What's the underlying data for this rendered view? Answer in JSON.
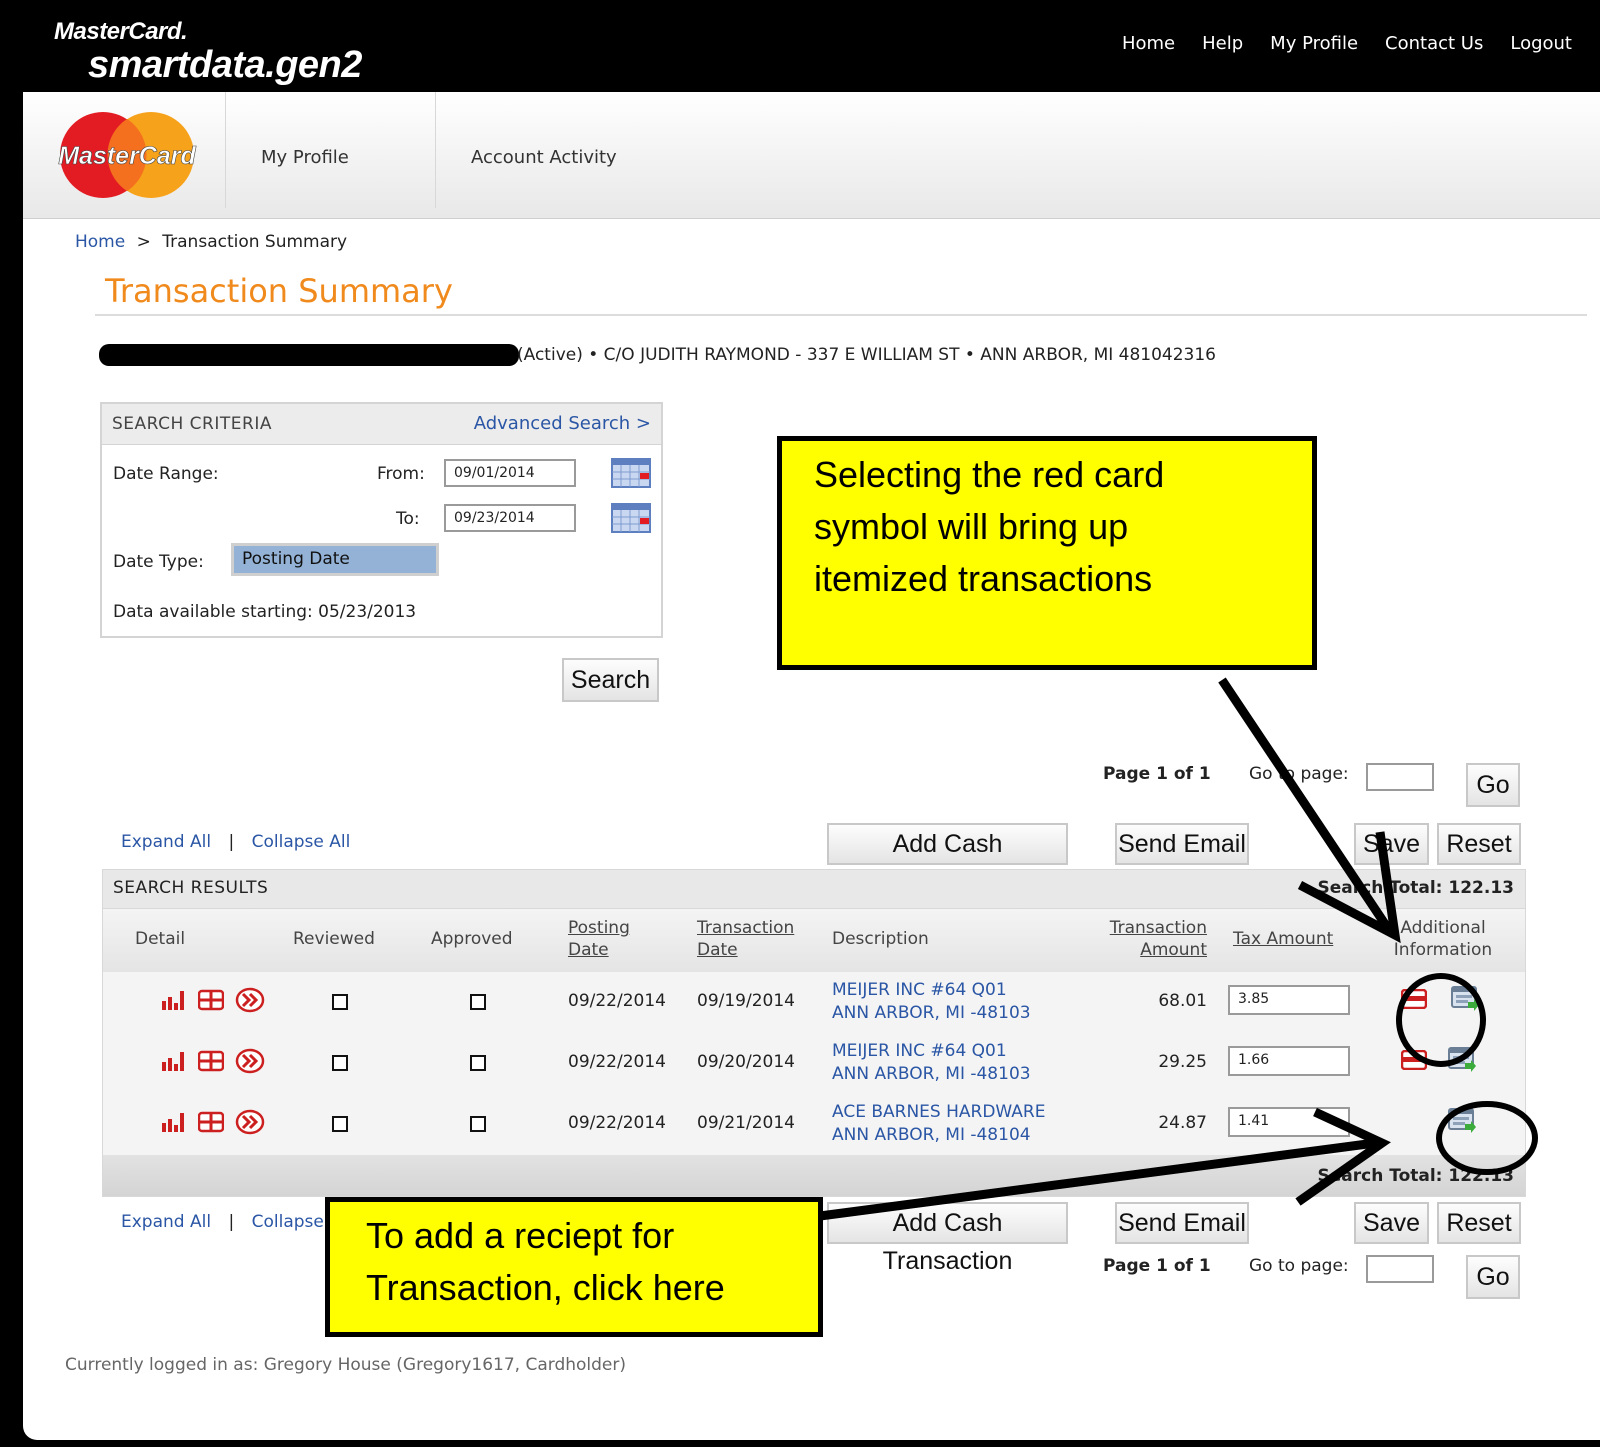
{
  "brand": {
    "line1": "MasterCard.",
    "line2": "smartdata.gen2",
    "logo_text": "MasterCard"
  },
  "topnav": [
    "Home",
    "Help",
    "My Profile",
    "Contact Us",
    "Logout"
  ],
  "header_nav": [
    "My Profile",
    "Account Activity"
  ],
  "breadcrumb": {
    "home": "Home",
    "sep": ">",
    "current": "Transaction Summary"
  },
  "page_title": "Transaction Summary",
  "account_line": "(Active) • C/O JUDITH RAYMOND - 337 E WILLIAM ST • ANN ARBOR, MI 481042316",
  "search": {
    "header": "SEARCH CRITERIA",
    "advanced": "Advanced Search >",
    "date_range_label": "Date Range:",
    "from_label": "From:",
    "from_value": "09/01/2014",
    "to_label": "To:",
    "to_value": "09/23/2014",
    "date_type_label": "Date Type:",
    "date_type_value": "Posting Date",
    "available": "Data available starting: 05/23/2013",
    "button": "Search"
  },
  "paging": {
    "page": "Page 1 of 1",
    "goto_label": "Go to page:",
    "go_button": "Go"
  },
  "actions": {
    "expand": "Expand All",
    "divider": "|",
    "collapse": "Collapse All",
    "add_cash": "Add Cash Transaction",
    "send_email": "Send Email",
    "save": "Save",
    "reset": "Reset"
  },
  "results": {
    "header": "SEARCH RESULTS",
    "total": "Search Total: 122.13",
    "columns": {
      "detail": "Detail",
      "reviewed": "Reviewed",
      "approved": "Approved",
      "posting1": "Posting",
      "posting2": "Date",
      "trans1": "Transaction",
      "trans2": "Date",
      "description": "Description",
      "amount1": "Transaction",
      "amount2": "Amount",
      "tax": "Tax Amount",
      "add1": "Additional",
      "add2": "Information"
    },
    "rows": [
      {
        "posting": "09/22/2014",
        "trans": "09/19/2014",
        "desc1": "MEIJER INC #64 Q01",
        "desc2": "ANN ARBOR, MI -48103",
        "amount": "68.01",
        "tax": "3.85"
      },
      {
        "posting": "09/22/2014",
        "trans": "09/20/2014",
        "desc1": "MEIJER INC #64 Q01",
        "desc2": "ANN ARBOR, MI -48103",
        "amount": "29.25",
        "tax": "1.66"
      },
      {
        "posting": "09/22/2014",
        "trans": "09/21/2014",
        "desc1": "ACE BARNES HARDWARE",
        "desc2": "ANN ARBOR, MI -48104",
        "amount": "24.87",
        "tax": "1.41"
      }
    ]
  },
  "callouts": {
    "top": [
      "Selecting the red card",
      "symbol will bring up",
      "itemized transactions"
    ],
    "bottom": [
      "To add a reciept for",
      "Transaction, click here"
    ]
  },
  "footer": "Currently logged in as: Gregory House (Gregory1617, Cardholder)",
  "colors": {
    "title_orange": "#f08a1c",
    "link_blue": "#2a56a5",
    "callout_yellow": "#ffff00",
    "icon_red": "#cc1f1f"
  }
}
